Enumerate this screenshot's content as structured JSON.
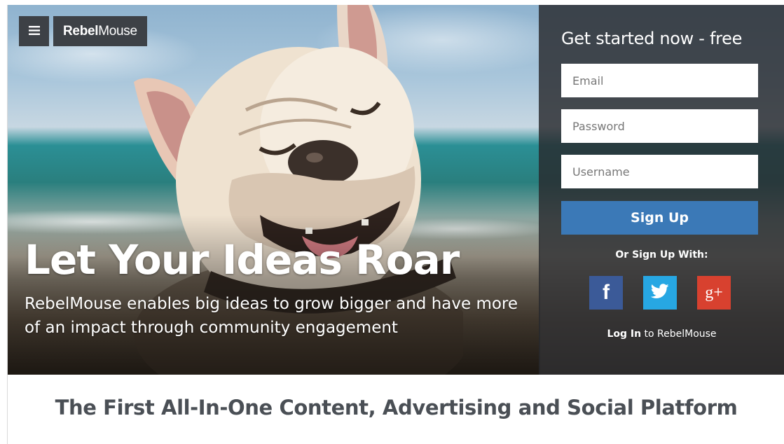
{
  "header": {
    "brand_bold": "Rebel",
    "brand_light": "Mouse",
    "menu_icon": "hamburger-menu-icon"
  },
  "hero": {
    "title": "Let Your Ideas Roar",
    "subtitle": "RebelMouse enables big ideas to grow bigger and have more of an impact through community engagement"
  },
  "signup": {
    "title": "Get started now - free",
    "email_placeholder": "Email",
    "password_placeholder": "Password",
    "username_placeholder": "Username",
    "button_label": "Sign Up",
    "or_text": "Or Sign Up With:",
    "social": [
      {
        "name": "facebook",
        "glyph": "f",
        "color": "#3b5a98"
      },
      {
        "name": "twitter",
        "glyph": "",
        "color": "#27a7e3"
      },
      {
        "name": "google-plus",
        "glyph": "g+",
        "color": "#d8412f"
      }
    ],
    "login_strong": "Log In",
    "login_rest": " to RebelMouse",
    "accent_color": "#3b79b7"
  },
  "tagline": "The First All-In-One Content, Advertising and Social Platform"
}
